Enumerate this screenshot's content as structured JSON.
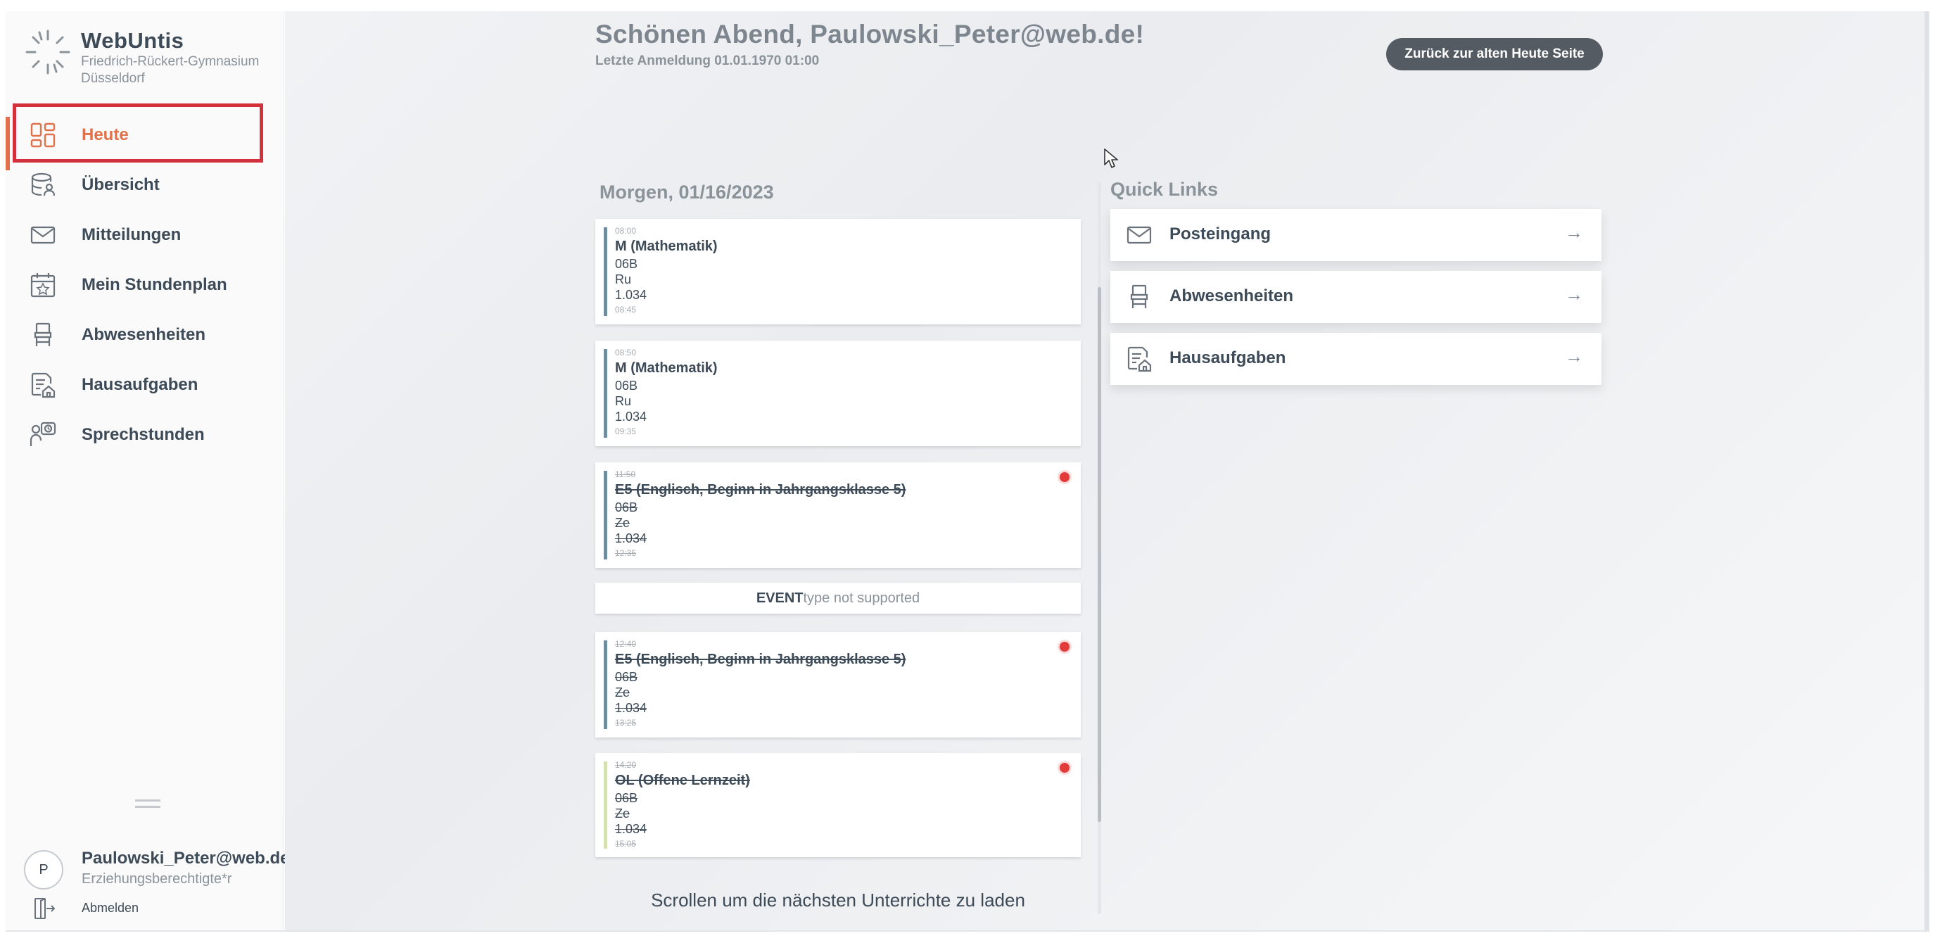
{
  "app": {
    "brand_name": "WebUntis",
    "school_name": "Friedrich-Rückert-Gymnasium Düsseldorf"
  },
  "sidebar": {
    "items": [
      {
        "label": "Heute",
        "icon": "dashboard-icon",
        "active": true
      },
      {
        "label": "Übersicht",
        "icon": "overview-icon",
        "active": false
      },
      {
        "label": "Mitteilungen",
        "icon": "mail-icon",
        "active": false
      },
      {
        "label": "Mein Stundenplan",
        "icon": "calendar-star-icon",
        "active": false
      },
      {
        "label": "Abwesenheiten",
        "icon": "chair-icon",
        "active": false
      },
      {
        "label": "Hausaufgaben",
        "icon": "homework-icon",
        "active": false
      },
      {
        "label": "Sprechstunden",
        "icon": "consultation-icon",
        "active": false
      }
    ],
    "user": {
      "avatar_letter": "P",
      "name": "Paulowski_Peter@web.de",
      "role": "Erziehungsberechtigte*r",
      "logout_label": "Abmelden"
    }
  },
  "header": {
    "greeting": "Schönen Abend, Paulowski_Peter@web.de!",
    "last_login": "Letzte Anmeldung 01.01.1970 01:00",
    "back_button": "Zurück zur alten Heute Seite"
  },
  "schedule": {
    "day_heading": "Morgen, 01/16/2023",
    "lessons": [
      {
        "start": "08:00",
        "title": "M (Mathematik)",
        "class": "06B",
        "teacher": "Ru",
        "room": "1.034",
        "end": "08:45",
        "cancelled": false
      },
      {
        "start": "08:50",
        "title": "M (Mathematik)",
        "class": "06B",
        "teacher": "Ru",
        "room": "1.034",
        "end": "09:35",
        "cancelled": false
      },
      {
        "start": "11:50",
        "title": "E5 (Englisch, Beginn in Jahrgangsklasse 5)",
        "class": "06B",
        "teacher": "Ze",
        "room": "1.034",
        "end": "12:35",
        "cancelled": true
      },
      {
        "start": "12:40",
        "title": "E5 (Englisch, Beginn in Jahrgangsklasse 5)",
        "class": "06B",
        "teacher": "Ze",
        "room": "1.034",
        "end": "13:25",
        "cancelled": true
      },
      {
        "start": "14:20",
        "title": "OL (Offene Lernzeit)",
        "class": "06B",
        "teacher": "Ze",
        "room": "1.034",
        "end": "15:05",
        "cancelled": true
      }
    ],
    "event": {
      "bold": "EVENT",
      "rest": "type not supported"
    },
    "scroll_hint": "Scrollen um die nächsten Unterrichte zu laden"
  },
  "quick_links": {
    "heading": "Quick Links",
    "items": [
      {
        "label": "Posteingang",
        "icon": "mail-icon",
        "arrow": "→"
      },
      {
        "label": "Abwesenheiten",
        "icon": "chair-icon",
        "arrow": "→"
      },
      {
        "label": "Hausaufgaben",
        "icon": "homework-icon",
        "arrow": "→"
      }
    ]
  },
  "colors": {
    "accent": "#e2714a",
    "highlight_box": "#d2303c",
    "lesson_bar": "#6c8ea0",
    "lesson_bar_free": "#d4e1b3",
    "cancel_dot": "#e33a3a",
    "button_bg": "#555b63"
  }
}
